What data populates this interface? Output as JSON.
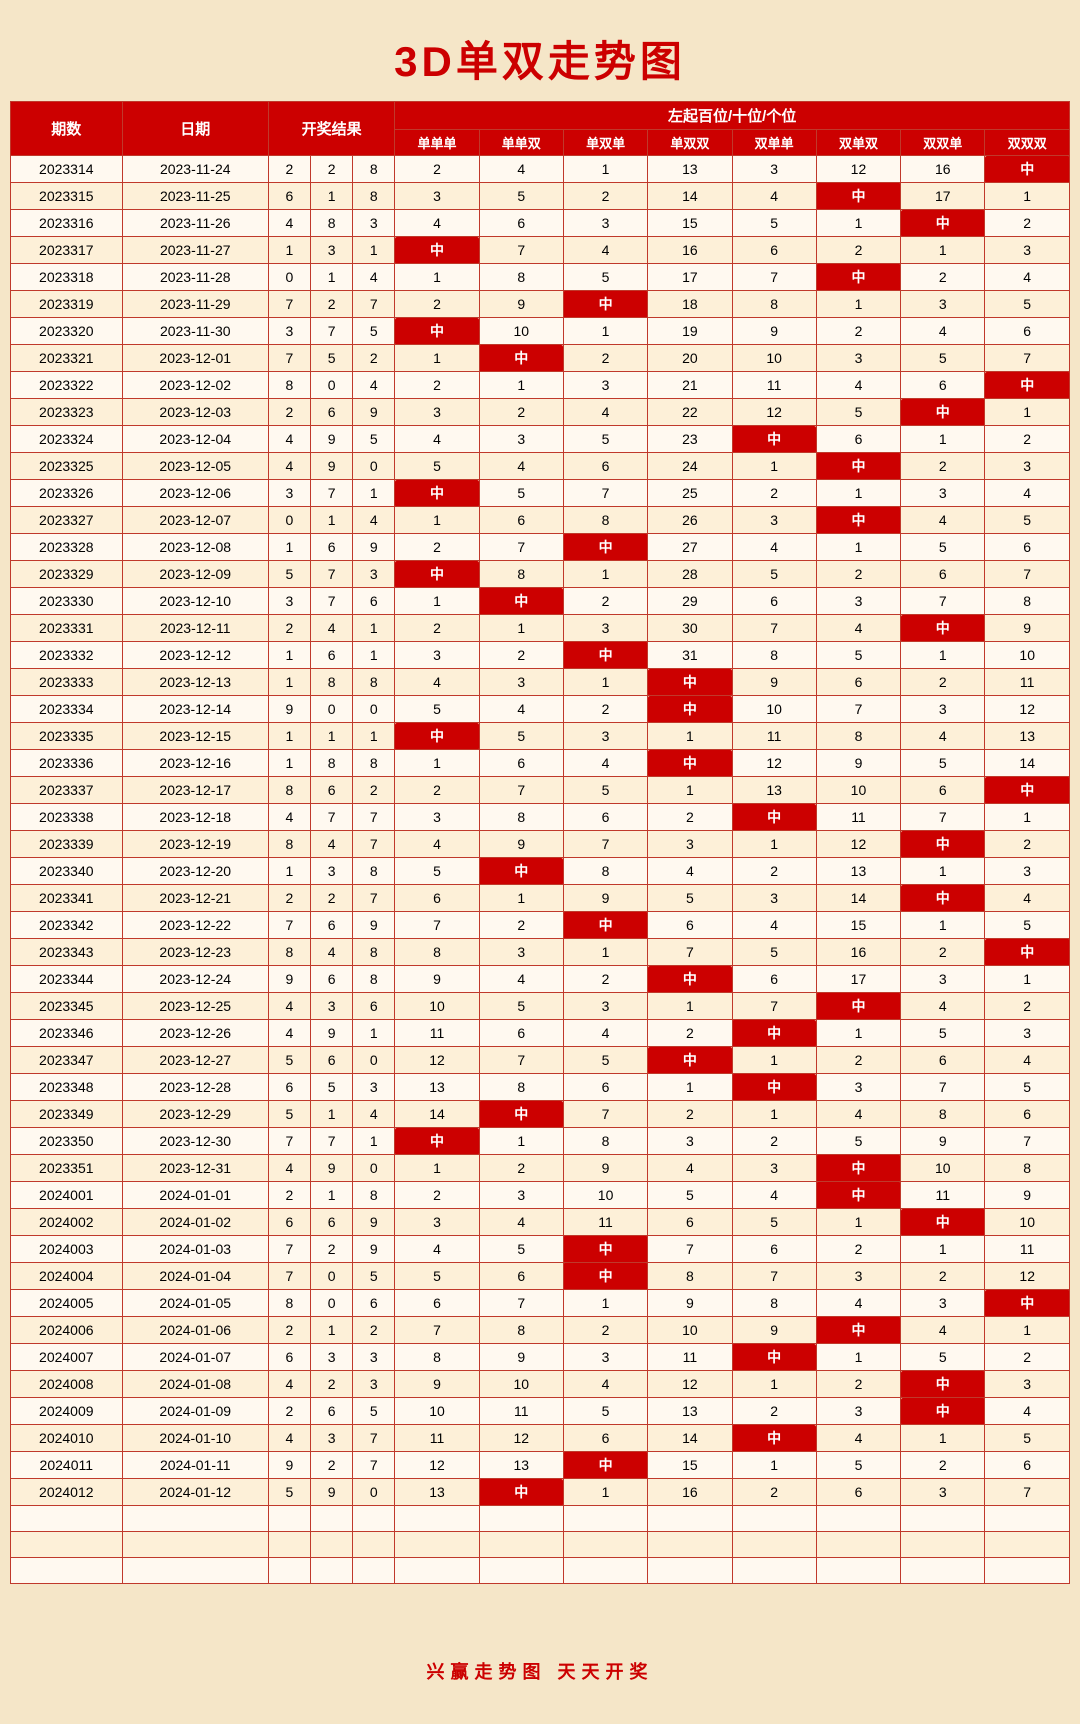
{
  "title": "3D单双走势图",
  "subtitle_left": "左起百位/十位/个位",
  "headers": {
    "qishu": "期数",
    "date": "日期",
    "kaijiangjieguo": "开奖结果",
    "cols": [
      "单单单",
      "单单双",
      "单双单",
      "单双双",
      "双单单",
      "双单双",
      "双双单",
      "双双双"
    ]
  },
  "footer": "兴赢走势图   天天开奖",
  "rows": [
    {
      "id": "2023314",
      "date": "2023-11-24",
      "r": [
        2,
        2,
        8
      ],
      "c": [
        2,
        4,
        1,
        13,
        3,
        12,
        16,
        "中"
      ]
    },
    {
      "id": "2023315",
      "date": "2023-11-25",
      "r": [
        6,
        1,
        8
      ],
      "c": [
        3,
        5,
        2,
        14,
        4,
        "中",
        17,
        1
      ]
    },
    {
      "id": "2023316",
      "date": "2023-11-26",
      "r": [
        4,
        8,
        3
      ],
      "c": [
        4,
        6,
        3,
        15,
        5,
        1,
        "中",
        2
      ]
    },
    {
      "id": "2023317",
      "date": "2023-11-27",
      "r": [
        1,
        3,
        1
      ],
      "c": [
        "中",
        7,
        4,
        16,
        6,
        2,
        1,
        3
      ]
    },
    {
      "id": "2023318",
      "date": "2023-11-28",
      "r": [
        0,
        1,
        4
      ],
      "c": [
        1,
        8,
        5,
        17,
        7,
        "中",
        2,
        4
      ]
    },
    {
      "id": "2023319",
      "date": "2023-11-29",
      "r": [
        7,
        2,
        7
      ],
      "c": [
        2,
        9,
        "中",
        18,
        8,
        1,
        3,
        5
      ]
    },
    {
      "id": "2023320",
      "date": "2023-11-30",
      "r": [
        3,
        7,
        5
      ],
      "c": [
        "中",
        10,
        1,
        19,
        9,
        2,
        4,
        6
      ]
    },
    {
      "id": "2023321",
      "date": "2023-12-01",
      "r": [
        7,
        5,
        2
      ],
      "c": [
        1,
        "中",
        2,
        20,
        10,
        3,
        5,
        7
      ]
    },
    {
      "id": "2023322",
      "date": "2023-12-02",
      "r": [
        8,
        0,
        4
      ],
      "c": [
        2,
        1,
        3,
        21,
        11,
        4,
        6,
        "中"
      ]
    },
    {
      "id": "2023323",
      "date": "2023-12-03",
      "r": [
        2,
        6,
        9
      ],
      "c": [
        3,
        2,
        4,
        22,
        12,
        5,
        "中",
        1
      ]
    },
    {
      "id": "2023324",
      "date": "2023-12-04",
      "r": [
        4,
        9,
        5
      ],
      "c": [
        4,
        3,
        5,
        23,
        "中",
        6,
        1,
        2
      ]
    },
    {
      "id": "2023325",
      "date": "2023-12-05",
      "r": [
        4,
        9,
        0
      ],
      "c": [
        5,
        4,
        6,
        24,
        1,
        "中",
        2,
        3
      ]
    },
    {
      "id": "2023326",
      "date": "2023-12-06",
      "r": [
        3,
        7,
        1
      ],
      "c": [
        "中",
        5,
        7,
        25,
        2,
        1,
        3,
        4
      ]
    },
    {
      "id": "2023327",
      "date": "2023-12-07",
      "r": [
        0,
        1,
        4
      ],
      "c": [
        1,
        6,
        8,
        26,
        3,
        "中",
        4,
        5
      ]
    },
    {
      "id": "2023328",
      "date": "2023-12-08",
      "r": [
        1,
        6,
        9
      ],
      "c": [
        2,
        7,
        "中",
        27,
        4,
        1,
        5,
        6
      ]
    },
    {
      "id": "2023329",
      "date": "2023-12-09",
      "r": [
        5,
        7,
        3
      ],
      "c": [
        "中",
        8,
        1,
        28,
        5,
        2,
        6,
        7
      ]
    },
    {
      "id": "2023330",
      "date": "2023-12-10",
      "r": [
        3,
        7,
        6
      ],
      "c": [
        1,
        "中",
        2,
        29,
        6,
        3,
        7,
        8
      ]
    },
    {
      "id": "2023331",
      "date": "2023-12-11",
      "r": [
        2,
        4,
        1
      ],
      "c": [
        2,
        1,
        3,
        30,
        7,
        4,
        "中",
        9
      ]
    },
    {
      "id": "2023332",
      "date": "2023-12-12",
      "r": [
        1,
        6,
        1
      ],
      "c": [
        3,
        2,
        "中",
        31,
        8,
        5,
        1,
        10
      ]
    },
    {
      "id": "2023333",
      "date": "2023-12-13",
      "r": [
        1,
        8,
        8
      ],
      "c": [
        4,
        3,
        1,
        "中",
        9,
        6,
        2,
        11
      ]
    },
    {
      "id": "2023334",
      "date": "2023-12-14",
      "r": [
        9,
        0,
        0
      ],
      "c": [
        5,
        4,
        2,
        "中",
        10,
        7,
        3,
        12
      ]
    },
    {
      "id": "2023335",
      "date": "2023-12-15",
      "r": [
        1,
        1,
        1
      ],
      "c": [
        "中",
        5,
        3,
        1,
        11,
        8,
        4,
        13
      ]
    },
    {
      "id": "2023336",
      "date": "2023-12-16",
      "r": [
        1,
        8,
        8
      ],
      "c": [
        1,
        6,
        4,
        "中",
        12,
        9,
        5,
        14
      ]
    },
    {
      "id": "2023337",
      "date": "2023-12-17",
      "r": [
        8,
        6,
        2
      ],
      "c": [
        2,
        7,
        5,
        1,
        13,
        10,
        6,
        "中"
      ]
    },
    {
      "id": "2023338",
      "date": "2023-12-18",
      "r": [
        4,
        7,
        7
      ],
      "c": [
        3,
        8,
        6,
        2,
        "中",
        11,
        7,
        1
      ]
    },
    {
      "id": "2023339",
      "date": "2023-12-19",
      "r": [
        8,
        4,
        7
      ],
      "c": [
        4,
        9,
        7,
        3,
        1,
        12,
        "中",
        2
      ]
    },
    {
      "id": "2023340",
      "date": "2023-12-20",
      "r": [
        1,
        3,
        8
      ],
      "c": [
        5,
        "中",
        8,
        4,
        2,
        13,
        1,
        3
      ]
    },
    {
      "id": "2023341",
      "date": "2023-12-21",
      "r": [
        2,
        2,
        7
      ],
      "c": [
        6,
        1,
        9,
        5,
        3,
        14,
        "中",
        4
      ]
    },
    {
      "id": "2023342",
      "date": "2023-12-22",
      "r": [
        7,
        6,
        9
      ],
      "c": [
        7,
        2,
        "中",
        6,
        4,
        15,
        1,
        5
      ]
    },
    {
      "id": "2023343",
      "date": "2023-12-23",
      "r": [
        8,
        4,
        8
      ],
      "c": [
        8,
        3,
        1,
        7,
        5,
        16,
        2,
        "中"
      ]
    },
    {
      "id": "2023344",
      "date": "2023-12-24",
      "r": [
        9,
        6,
        8
      ],
      "c": [
        9,
        4,
        2,
        "中",
        6,
        17,
        3,
        1
      ]
    },
    {
      "id": "2023345",
      "date": "2023-12-25",
      "r": [
        4,
        3,
        6
      ],
      "c": [
        10,
        5,
        3,
        1,
        7,
        "中",
        4,
        2
      ]
    },
    {
      "id": "2023346",
      "date": "2023-12-26",
      "r": [
        4,
        9,
        1
      ],
      "c": [
        11,
        6,
        4,
        2,
        "中",
        1,
        5,
        3
      ]
    },
    {
      "id": "2023347",
      "date": "2023-12-27",
      "r": [
        5,
        6,
        0
      ],
      "c": [
        12,
        7,
        5,
        "中",
        1,
        2,
        6,
        4
      ]
    },
    {
      "id": "2023348",
      "date": "2023-12-28",
      "r": [
        6,
        5,
        3
      ],
      "c": [
        13,
        8,
        6,
        1,
        "中",
        3,
        7,
        5
      ]
    },
    {
      "id": "2023349",
      "date": "2023-12-29",
      "r": [
        5,
        1,
        4
      ],
      "c": [
        14,
        "中",
        7,
        2,
        1,
        4,
        8,
        6
      ]
    },
    {
      "id": "2023350",
      "date": "2023-12-30",
      "r": [
        7,
        7,
        1
      ],
      "c": [
        "中",
        1,
        8,
        3,
        2,
        5,
        9,
        7
      ]
    },
    {
      "id": "2023351",
      "date": "2023-12-31",
      "r": [
        4,
        9,
        0
      ],
      "c": [
        1,
        2,
        9,
        4,
        3,
        "中",
        10,
        8
      ]
    },
    {
      "id": "2024001",
      "date": "2024-01-01",
      "r": [
        2,
        1,
        8
      ],
      "c": [
        2,
        3,
        10,
        5,
        4,
        "中",
        11,
        9
      ]
    },
    {
      "id": "2024002",
      "date": "2024-01-02",
      "r": [
        6,
        6,
        9
      ],
      "c": [
        3,
        4,
        11,
        6,
        5,
        1,
        "中",
        10
      ]
    },
    {
      "id": "2024003",
      "date": "2024-01-03",
      "r": [
        7,
        2,
        9
      ],
      "c": [
        4,
        5,
        "中",
        7,
        6,
        2,
        1,
        11
      ]
    },
    {
      "id": "2024004",
      "date": "2024-01-04",
      "r": [
        7,
        0,
        5
      ],
      "c": [
        5,
        6,
        "中",
        8,
        7,
        3,
        2,
        12
      ]
    },
    {
      "id": "2024005",
      "date": "2024-01-05",
      "r": [
        8,
        0,
        6
      ],
      "c": [
        6,
        7,
        1,
        9,
        8,
        4,
        3,
        "中"
      ]
    },
    {
      "id": "2024006",
      "date": "2024-01-06",
      "r": [
        2,
        1,
        2
      ],
      "c": [
        7,
        8,
        2,
        10,
        9,
        "中",
        4,
        1
      ]
    },
    {
      "id": "2024007",
      "date": "2024-01-07",
      "r": [
        6,
        3,
        3
      ],
      "c": [
        8,
        9,
        3,
        11,
        "中",
        1,
        5,
        2
      ]
    },
    {
      "id": "2024008",
      "date": "2024-01-08",
      "r": [
        4,
        2,
        3
      ],
      "c": [
        9,
        10,
        4,
        12,
        1,
        2,
        "中",
        3
      ]
    },
    {
      "id": "2024009",
      "date": "2024-01-09",
      "r": [
        2,
        6,
        5
      ],
      "c": [
        10,
        11,
        5,
        13,
        2,
        3,
        "中",
        4
      ]
    },
    {
      "id": "2024010",
      "date": "2024-01-10",
      "r": [
        4,
        3,
        7
      ],
      "c": [
        11,
        12,
        6,
        14,
        "中",
        4,
        1,
        5
      ]
    },
    {
      "id": "2024011",
      "date": "2024-01-11",
      "r": [
        9,
        2,
        7
      ],
      "c": [
        12,
        13,
        "中",
        15,
        1,
        5,
        2,
        6
      ]
    },
    {
      "id": "2024012",
      "date": "2024-01-12",
      "r": [
        5,
        9,
        0
      ],
      "c": [
        13,
        "中",
        1,
        16,
        2,
        6,
        3,
        7
      ]
    }
  ]
}
